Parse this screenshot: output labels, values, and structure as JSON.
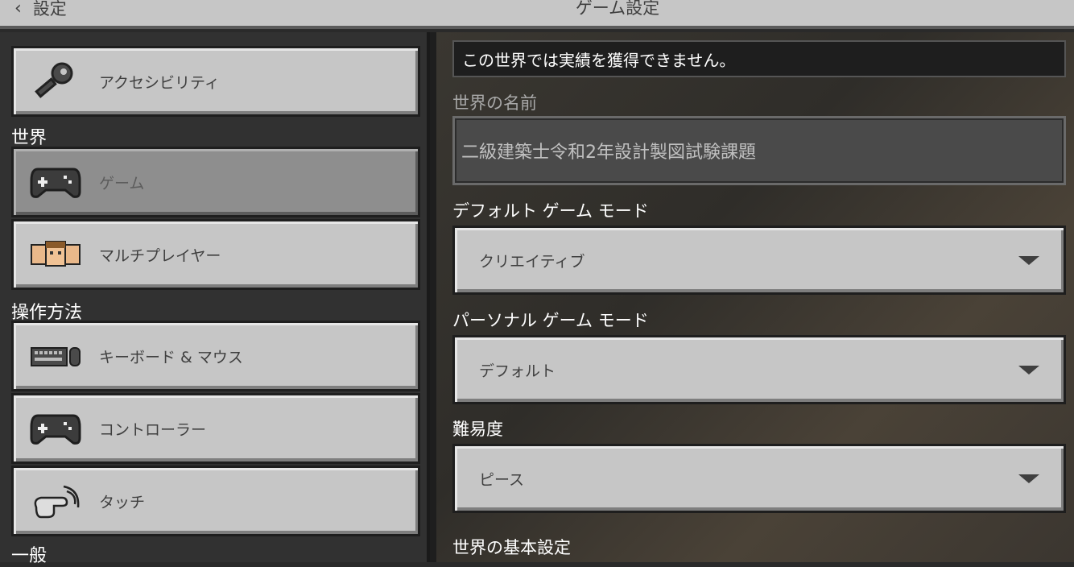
{
  "header": {
    "back_label": "設定",
    "title": "ゲーム設定"
  },
  "sidebar": {
    "items": [
      {
        "label": "アクセシビリティ",
        "icon": "key-icon"
      },
      {
        "label": "ゲーム",
        "icon": "gamepad-icon"
      },
      {
        "label": "マルチプレイヤー",
        "icon": "players-icon"
      },
      {
        "label": "キーボード & マウス",
        "icon": "keyboard-mouse-icon"
      },
      {
        "label": "コントローラー",
        "icon": "gamepad-icon"
      },
      {
        "label": "タッチ",
        "icon": "touch-icon"
      }
    ],
    "sections": {
      "world": "世界",
      "controls": "操作方法",
      "general": "一般"
    }
  },
  "main": {
    "notice": "この世界では実績を獲得できません。",
    "world_name_label": "世界の名前",
    "world_name_value": "二級建築士令和2年設計製図試験課題",
    "default_mode_label": "デフォルト ゲーム モード",
    "default_mode_value": "クリエイティブ",
    "personal_mode_label": "パーソナル ゲーム モード",
    "personal_mode_value": "デフォルト",
    "difficulty_label": "難易度",
    "difficulty_value": "ピース",
    "world_prefs_label": "世界の基本設定"
  },
  "colors": {
    "button": "#c6c6c6",
    "button_active": "#8e8e8e",
    "panel": "#313131",
    "text_dark": "#3f3f3f"
  }
}
